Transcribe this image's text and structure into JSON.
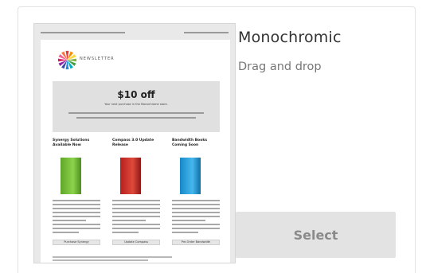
{
  "template": {
    "title": "Monochromic",
    "subtitle": "Drag and drop",
    "select_label": "Select"
  },
  "preview": {
    "logo_text": "NEWSLETTER",
    "offer_title": "$10 off",
    "offer_subtitle": "Your next purchase in the Monochrome store.",
    "columns": [
      {
        "heading": "Synergy Solutions Available Now",
        "button": "Purchase Synergy"
      },
      {
        "heading": "Compass 3.0 Update Release",
        "button": "Update Compass"
      },
      {
        "heading": "Bandwidth Books Coming Soon",
        "button": "Pre-Order Bandwidth"
      }
    ]
  },
  "colors": {
    "select_bg": "#e3e3e3",
    "select_text": "#8a8a8a",
    "green_box": "#7cc43c",
    "red_box": "#d83a2e",
    "blue_box": "#2fa6e0"
  }
}
